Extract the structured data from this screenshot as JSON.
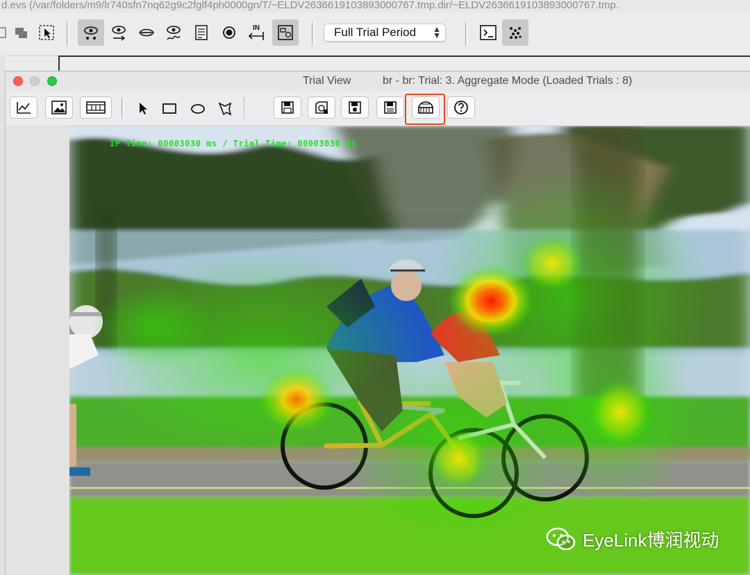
{
  "path_bar": {
    "text": "d.evs (/var/folders/m9/lr740sfn7nq62g9c2fglf4ph0000gn/T/~ELDV2636619103893000767.tmp.dir/~ELDV2636619103893000767.tmp."
  },
  "outer_toolbar": {
    "period_select": {
      "value": "Full Trial Period"
    },
    "buttons": [
      {
        "name": "fixation-view-icon",
        "pressed": true
      },
      {
        "name": "saccade-view-icon",
        "pressed": false
      },
      {
        "name": "blink-view-icon",
        "pressed": false
      },
      {
        "name": "sample-view-icon",
        "pressed": false
      },
      {
        "name": "report-icon",
        "pressed": false
      },
      {
        "name": "target-icon",
        "pressed": false
      },
      {
        "name": "interest-period-icon",
        "label": "IN",
        "pressed": false
      },
      {
        "name": "interest-area-icon",
        "pressed": true
      },
      {
        "name": "console-icon",
        "pressed": false
      },
      {
        "name": "grid-dots-icon",
        "pressed": true
      }
    ]
  },
  "trial_window": {
    "title": "Trial View",
    "subtitle": "br - br: Trial: 3. Aggregate Mode (Loaded Trials : 8)",
    "toolbar": {
      "view_buttons": [
        "line-chart-icon",
        "image-view-icon",
        "film-view-icon"
      ],
      "tools": [
        "select-arrow-icon",
        "rectangle-tool-icon",
        "ellipse-tool-icon",
        "freehand-tool-icon"
      ],
      "actions": [
        "save-image-icon",
        "save-all-images-icon",
        "save-trial-icon",
        "save-icon",
        "heatmap-icon",
        "help-icon"
      ]
    },
    "overlay_text": "IP Time: 00003030 ms  /  Trial Time: 00003030 ms"
  },
  "watermark": {
    "text": "EyeLink博润视动"
  },
  "colors": {
    "highlight": "#e8471d",
    "overlay_text": "#20e020",
    "heat_hot": "#ff2a00",
    "heat_mid": "#ffe600",
    "heat_low": "#33e000"
  }
}
